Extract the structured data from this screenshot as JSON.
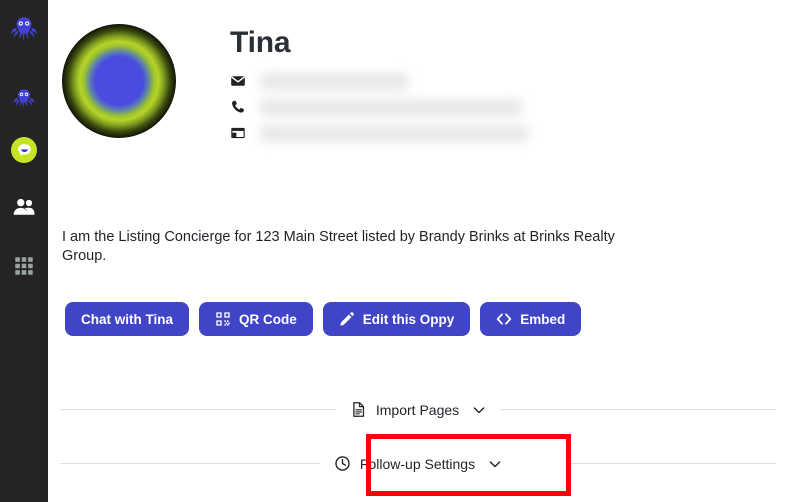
{
  "app": {
    "brand_dark": "#242424",
    "accent": "#4045c8",
    "highlight": "#fb0007",
    "badge_green": "#c6e326"
  },
  "sidebar": {
    "items": [
      {
        "name": "octopus-logo",
        "icon": "octopus-icon",
        "label": ""
      },
      {
        "name": "octopus-nav",
        "icon": "octopus-icon",
        "label": ""
      },
      {
        "name": "chat-nav",
        "icon": "chat-bubble-icon",
        "label": ""
      },
      {
        "name": "contacts-nav",
        "icon": "people-icon",
        "label": ""
      },
      {
        "name": "apps-nav",
        "icon": "grid-icon",
        "label": ""
      }
    ]
  },
  "profile": {
    "name": "Tina",
    "avatar_alt": "Tina avatar",
    "contacts": [
      {
        "icon": "envelope-icon",
        "value": "",
        "redacted": true
      },
      {
        "icon": "phone-icon",
        "value": "",
        "redacted": true
      },
      {
        "icon": "browser-window-icon",
        "value": "",
        "redacted": true
      }
    ],
    "description": "I am the Listing Concierge for 123 Main Street listed by Brandy Brinks at Brinks Realty Group."
  },
  "actions": [
    {
      "label": "Chat with Tina",
      "icon": null,
      "name": "chat-with-tina-button"
    },
    {
      "label": "QR Code",
      "icon": "qr-code-icon",
      "name": "qr-code-button"
    },
    {
      "label": "Edit this Oppy",
      "icon": "pencil-icon",
      "name": "edit-this-oppy-button"
    },
    {
      "label": "Embed",
      "icon": "code-brackets-icon",
      "name": "embed-button"
    }
  ],
  "sections": [
    {
      "label": "Import Pages",
      "icon": "document-icon",
      "chevron": "chevron-down-icon",
      "expanded": false,
      "highlighted": false
    },
    {
      "label": "Follow-up Settings",
      "icon": "clock-icon",
      "chevron": "chevron-down-icon",
      "expanded": false,
      "highlighted": true
    }
  ]
}
